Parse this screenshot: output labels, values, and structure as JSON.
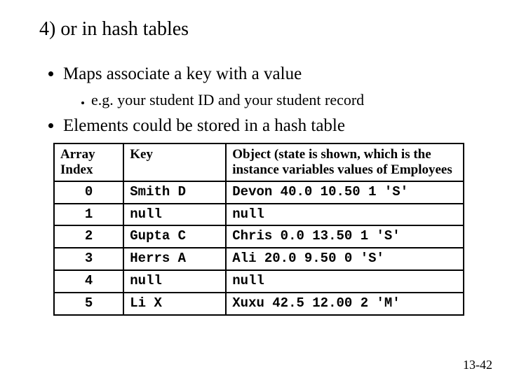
{
  "title": "4) or in hash tables",
  "bullets": {
    "b1": "Maps associate a key with a value",
    "b1a": "e.g. your student ID and your student record",
    "b2": "Elements could be stored in a hash table"
  },
  "table": {
    "headers": {
      "index": "Array Index",
      "key": "Key",
      "object": "Object (state is shown, which is the instance variables values of Employees"
    },
    "rows": [
      {
        "index": "0",
        "key": "Smith D",
        "object": "Devon 40.0 10.50 1 'S'"
      },
      {
        "index": "1",
        "key": "null",
        "object": "null"
      },
      {
        "index": "2",
        "key": "Gupta C",
        "object": "Chris 0.0 13.50 1 'S'"
      },
      {
        "index": "3",
        "key": "Herrs A",
        "object": "Ali 20.0 9.50 0 'S'"
      },
      {
        "index": "4",
        "key": "null",
        "object": "null"
      },
      {
        "index": "5",
        "key": "Li X",
        "object": "Xuxu 42.5 12.00 2 'M'"
      }
    ]
  },
  "footer": "13-42"
}
